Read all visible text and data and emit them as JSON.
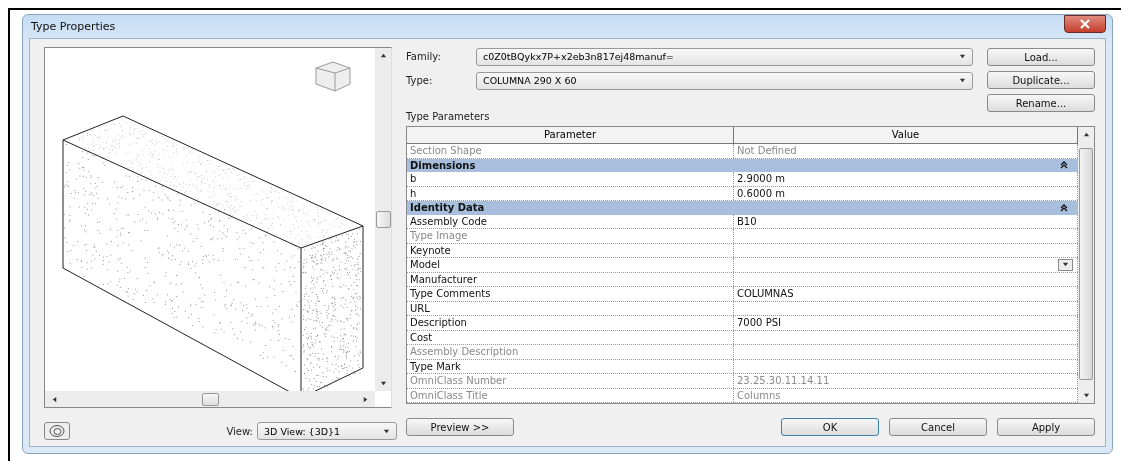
{
  "window": {
    "title": "Type Properties"
  },
  "family": {
    "label": "Family:",
    "value": "c0Z0tBQykx7P+x2eb3n817ej48manuf="
  },
  "type": {
    "label": "Type:",
    "value": "COLUMNA 290 X 60"
  },
  "side_buttons": [
    "Load...",
    "Duplicate...",
    "Rename..."
  ],
  "type_parameters": {
    "title": "Type Parameters",
    "columns": [
      "Parameter",
      "Value"
    ],
    "rows": [
      {
        "kind": "param",
        "name": "Section Shape",
        "value": "Not Defined",
        "disabled": true
      },
      {
        "kind": "group",
        "name": "Dimensions",
        "expanded": true
      },
      {
        "kind": "param",
        "name": "b",
        "value": "2.9000 m",
        "disabled": false
      },
      {
        "kind": "param",
        "name": "h",
        "value": "0.6000 m",
        "disabled": false
      },
      {
        "kind": "group",
        "name": "Identity Data",
        "expanded": true
      },
      {
        "kind": "param",
        "name": "Assembly Code",
        "value": "B10",
        "disabled": false
      },
      {
        "kind": "param",
        "name": "Type Image",
        "disabled": true
      },
      {
        "kind": "param",
        "name": "Keynote",
        "disabled": false
      },
      {
        "kind": "param",
        "name": "Model",
        "disabled": false,
        "dropdown": true
      },
      {
        "kind": "param",
        "name": "Manufacturer",
        "disabled": false
      },
      {
        "kind": "param",
        "name": "Type Comments",
        "value": "COLUMNAS",
        "disabled": false
      },
      {
        "kind": "param",
        "name": "URL",
        "disabled": false
      },
      {
        "kind": "param",
        "name": "Description",
        "value": "7000 PSI",
        "disabled": false
      },
      {
        "kind": "param",
        "name": "Cost",
        "disabled": false
      },
      {
        "kind": "param",
        "name": "Assembly Description",
        "disabled": true
      },
      {
        "kind": "param",
        "name": "Type Mark",
        "disabled": false
      },
      {
        "kind": "param",
        "name": "OmniClass Number",
        "value": "23.25.30.11.14.11",
        "disabled": true
      },
      {
        "kind": "param",
        "name": "OmniClass Title",
        "value": "Columns",
        "disabled": true
      }
    ]
  },
  "view": {
    "label": "View:",
    "value": "3D View: {3D}1"
  },
  "preview_button": "Preview >>",
  "buttons": [
    "OK",
    "Cancel",
    "Apply"
  ]
}
